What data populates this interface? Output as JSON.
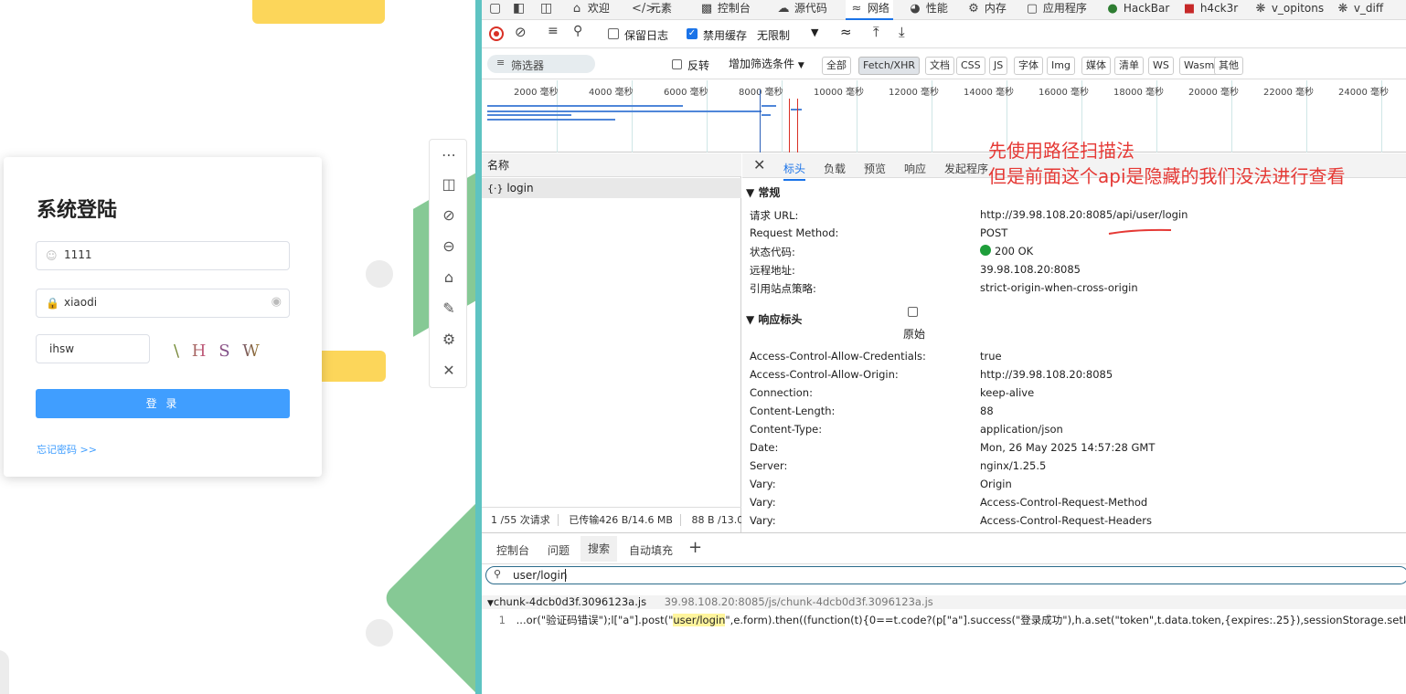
{
  "login": {
    "title": "系统登陆",
    "username": "1111",
    "password": "xiaodi",
    "captcha_input": "ihsw",
    "captcha_image": "\\ H S W",
    "login_button": "登 录",
    "forgot_link": "忘记密码 >>"
  },
  "devtools": {
    "tabs": [
      {
        "label": "欢迎",
        "icon": "home-icon"
      },
      {
        "label": "元素",
        "icon": "code-icon"
      },
      {
        "label": "控制台",
        "icon": "console-icon"
      },
      {
        "label": "源代码",
        "icon": "bug-icon"
      },
      {
        "label": "网络",
        "icon": "wifi-icon"
      },
      {
        "label": "性能",
        "icon": "gauge-icon"
      },
      {
        "label": "内存",
        "icon": "gear-icon"
      },
      {
        "label": "应用程序",
        "icon": "app-icon"
      },
      {
        "label": "HackBar",
        "icon": "hackbar-icon"
      },
      {
        "label": "h4ck3r",
        "icon": "hacker-icon"
      },
      {
        "label": "v_opitons",
        "icon": "puzzle-icon"
      },
      {
        "label": "v_diff",
        "icon": "puzzle-icon"
      }
    ],
    "toolbar": {
      "preserve_log": "保留日志",
      "disable_cache": "禁用缓存",
      "throttle": "无限制"
    },
    "filter": {
      "placeholder": "筛选器",
      "invert": "反转",
      "more_filters": "增加筛选条件",
      "chips": [
        "全部",
        "Fetch/XHR",
        "文档",
        "CSS",
        "JS",
        "字体",
        "Img",
        "媒体",
        "清单",
        "WS",
        "Wasm",
        "其他"
      ]
    },
    "timeline_ticks": [
      "2000 毫秒",
      "4000 毫秒",
      "6000 毫秒",
      "8000 毫秒",
      "10000 毫秒",
      "12000 毫秒",
      "14000 毫秒",
      "16000 毫秒",
      "18000 毫秒",
      "20000 毫秒",
      "22000 毫秒",
      "24000 毫秒"
    ],
    "request_list": {
      "header": "名称",
      "rows": [
        "login"
      ],
      "status": {
        "requests": "1 /55 次请求",
        "transferred": "已传输426 B/14.6 MB",
        "resources": "88 B /13.0"
      }
    },
    "detail": {
      "tabs": [
        "标头",
        "负载",
        "预览",
        "响应",
        "发起程序"
      ],
      "general_title": "常规",
      "general": [
        {
          "k": "请求 URL:",
          "v": "http://39.98.108.20:8085/api/user/login"
        },
        {
          "k": "Request Method:",
          "v": "POST"
        },
        {
          "k": "状态代码:",
          "v": "200 OK"
        },
        {
          "k": "远程地址:",
          "v": "39.98.108.20:8085"
        },
        {
          "k": "引用站点策略:",
          "v": "strict-origin-when-cross-origin"
        }
      ],
      "response_title": "响应标头",
      "raw_label": "原始",
      "response": [
        {
          "k": "Access-Control-Allow-Credentials:",
          "v": "true"
        },
        {
          "k": "Access-Control-Allow-Origin:",
          "v": "http://39.98.108.20:8085"
        },
        {
          "k": "Connection:",
          "v": "keep-alive"
        },
        {
          "k": "Content-Length:",
          "v": "88"
        },
        {
          "k": "Content-Type:",
          "v": "application/json"
        },
        {
          "k": "Date:",
          "v": "Mon, 26 May 2025 14:57:28 GMT"
        },
        {
          "k": "Server:",
          "v": "nginx/1.25.5"
        },
        {
          "k": "Vary:",
          "v": "Origin"
        },
        {
          "k": "Vary:",
          "v": "Access-Control-Request-Method"
        },
        {
          "k": "Vary:",
          "v": "Access-Control-Request-Headers"
        }
      ]
    },
    "annotation": {
      "line1": "先使用路径扫描法",
      "line2": "但是前面这个api是隐藏的我们没法进行查看"
    },
    "drawer": {
      "tabs": [
        "控制台",
        "问题",
        "搜索",
        "自动填充"
      ],
      "search_value": "user/login",
      "result_file": "chunk-4dcb0d3f.3096123a.js",
      "result_url": "39.98.108.20:8085/js/chunk-4dcb0d3f.3096123a.js",
      "line_no": "1",
      "code_pre": "...or(\"验证码错误\");l[\"a\"].post(\"",
      "code_match": "user/login",
      "code_post": "\",e.form).then((function(t){0==t.code?(p[\"a\"].success(\"登录成功\"),h.a.set(\"token\",t.data.token,{expires:.25}),sessionStorage.setItem(\"user\",JSON.strin"
    },
    "colors": {
      "accent": "#1a73e8",
      "status_ok": "#1e9e3a",
      "annotation": "#e53935",
      "login_button": "#409eff"
    }
  }
}
